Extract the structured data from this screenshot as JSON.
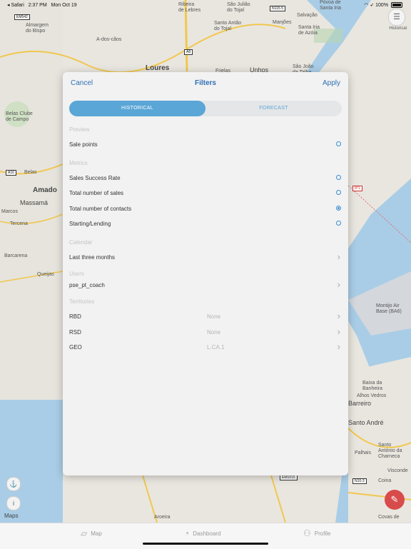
{
  "status_bar": {
    "carrier": "◂ Safari",
    "time": "2:37 PM",
    "date": "Mon Oct 19",
    "battery": "100%"
  },
  "map": {
    "labels": [
      {
        "text": "Almargem\ndo Bispo"
      },
      {
        "text": "A-dos-cãos"
      },
      {
        "text": "Loures"
      },
      {
        "text": "São Julião\ndo Tojal"
      },
      {
        "text": "Santo Antão\ndo Tojal"
      },
      {
        "text": "Ribeira\nde Lebres"
      },
      {
        "text": "Manjões"
      },
      {
        "text": "Salvação"
      },
      {
        "text": "Santa Iria\nde Azóia"
      },
      {
        "text": "Póvoa de\nSanta Iria"
      },
      {
        "text": "Belas Clube\nde Campo"
      },
      {
        "text": "Belas"
      },
      {
        "text": "Amado"
      },
      {
        "text": "Massamá"
      },
      {
        "text": "Marcos"
      },
      {
        "text": "Tercena"
      },
      {
        "text": "Barcarena"
      },
      {
        "text": "Queijas"
      },
      {
        "text": "São João\nda Talha"
      },
      {
        "text": "Unhos"
      },
      {
        "text": "Frielas"
      },
      {
        "text": "Montijo Air\nBase (BA6)"
      },
      {
        "text": "Baixa da\nBanheira"
      },
      {
        "text": "Alhos Vedros"
      },
      {
        "text": "Barreiro"
      },
      {
        "text": "Santo André"
      },
      {
        "text": "Palhais"
      },
      {
        "text": "Santo\nAntónio da\nCharneca"
      },
      {
        "text": "Visconde"
      },
      {
        "text": "Coina"
      },
      {
        "text": "Aroeira"
      },
      {
        "text": "Covas de"
      }
    ],
    "road_badges": [
      "EM542",
      "N115-5",
      "A8",
      "A16",
      "IP1",
      "EM1015",
      "N10-3"
    ],
    "control_label": "Historical",
    "maps_logo": "Maps"
  },
  "modal": {
    "cancel": "Cancel",
    "title": "Filters",
    "apply": "Apply",
    "segments": [
      "HISTORICAL",
      "FORECAST"
    ],
    "active_segment": "HISTORICAL",
    "preview": {
      "header": "Preview",
      "items": [
        {
          "label": "Sale points",
          "selected": false
        }
      ]
    },
    "metrics": {
      "header": "Metrics",
      "items": [
        {
          "label": "Sales Success Rate",
          "selected": false
        },
        {
          "label": "Total number of sales",
          "selected": false
        },
        {
          "label": "Total number of contacts",
          "selected": true
        },
        {
          "label": "Starting/Lending",
          "selected": false
        }
      ]
    },
    "calendar": {
      "header": "Calendar",
      "value": "Last three months"
    },
    "users": {
      "header": "Users",
      "value": "pse_pt_coach"
    },
    "territories": {
      "header": "Territories",
      "items": [
        {
          "label": "RBD",
          "value": "None"
        },
        {
          "label": "RSD",
          "value": "None"
        },
        {
          "label": "GEO",
          "value": "L.CA.1"
        }
      ]
    }
  },
  "tabbar": {
    "items": [
      {
        "label": "Map",
        "icon": "map-icon"
      },
      {
        "label": "Dashboard",
        "icon": "dashboard-icon"
      },
      {
        "label": "Profile",
        "icon": "person-icon"
      }
    ]
  },
  "colors": {
    "accent": "#2f6fb7",
    "segment_active": "#5aa6d6",
    "radio": "#3b8ed2",
    "fab": "#d84b4b",
    "water": "#a9cde6"
  }
}
